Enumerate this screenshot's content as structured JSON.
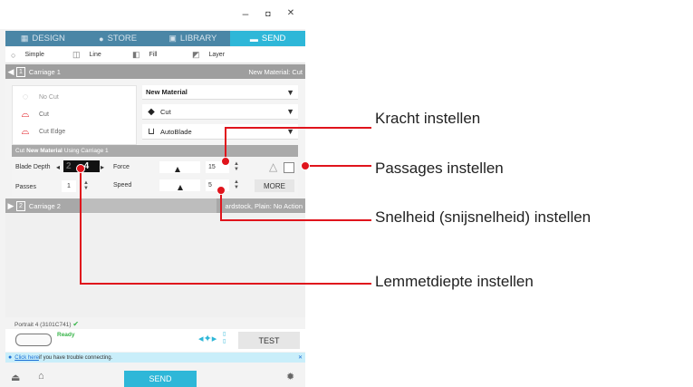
{
  "window": {
    "minimize": "–",
    "maximize": "◘",
    "close": "✕"
  },
  "tabs": [
    {
      "label": "DESIGN",
      "icon": "grid-icon"
    },
    {
      "label": "STORE",
      "icon": "store-icon"
    },
    {
      "label": "LIBRARY",
      "icon": "library-icon"
    },
    {
      "label": "SEND",
      "icon": "send-icon"
    }
  ],
  "modes": [
    {
      "label": "Simple",
      "icon": "radio-icon"
    },
    {
      "label": "Line",
      "icon": "line-icon"
    },
    {
      "label": "Fill",
      "icon": "fill-icon"
    },
    {
      "label": "Layer",
      "icon": "layer-icon"
    }
  ],
  "carriage1": {
    "num": "1",
    "label": "Carriage 1",
    "right": "New Material: Cut"
  },
  "actions": [
    "No Cut",
    "Cut",
    "Cut Edge"
  ],
  "material": {
    "name": "New Material",
    "action": "Cut",
    "tool": "AutoBlade"
  },
  "cutbar": {
    "prefix": "Cut ",
    "material": "New Material",
    "suffix": " Using Carriage 1"
  },
  "settings": {
    "blade_depth_label": "Blade Depth",
    "blade_depth_value": "4",
    "blade_depth_prev": "2",
    "force_label": "Force",
    "force_value": "15",
    "passes_label": "Passes",
    "passes_value": "1",
    "speed_label": "Speed",
    "speed_value": "5",
    "more_label": "MORE"
  },
  "carriage2": {
    "num": "2",
    "label": "Carriage 2",
    "right": "ardstock, Plain: No Action"
  },
  "status": {
    "device": "Portrait 4 (3101C741)",
    "ready": "Ready",
    "test_label": "TEST"
  },
  "info": {
    "link": "Click here",
    "text": " if you have trouble connecting."
  },
  "send_label": "SEND",
  "annotations": {
    "force": "Kracht instellen",
    "passes": "Passages instellen",
    "speed": "Snelheid (snijsnelheid) instellen",
    "blade": "Lemmetdiepte instellen"
  },
  "colors": {
    "accent": "#2eb7d8",
    "tab_bar": "#4a86a6",
    "callout": "#e0141c"
  }
}
